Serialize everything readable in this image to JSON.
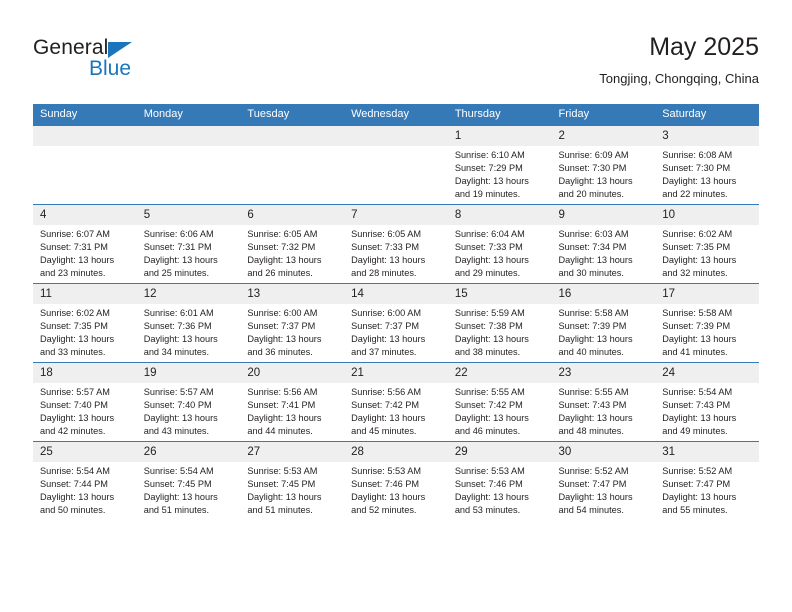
{
  "logo": {
    "word1": "General",
    "word2": "Blue",
    "accent_color": "#1b75bb",
    "triangle_icon": "triangle-icon"
  },
  "header": {
    "title": "May 2025",
    "subtitle": "Tongjing, Chongqing, China",
    "header_bg_color": "#3579b7",
    "daynum_bg_color": "#efefef"
  },
  "weekday_headers": [
    "Sunday",
    "Monday",
    "Tuesday",
    "Wednesday",
    "Thursday",
    "Friday",
    "Saturday"
  ],
  "weeks": [
    [
      {
        "day": "",
        "sunrise": "",
        "sunset": "",
        "daylight_1": "",
        "daylight_2": ""
      },
      {
        "day": "",
        "sunrise": "",
        "sunset": "",
        "daylight_1": "",
        "daylight_2": ""
      },
      {
        "day": "",
        "sunrise": "",
        "sunset": "",
        "daylight_1": "",
        "daylight_2": ""
      },
      {
        "day": "",
        "sunrise": "",
        "sunset": "",
        "daylight_1": "",
        "daylight_2": ""
      },
      {
        "day": "1",
        "sunrise": "Sunrise: 6:10 AM",
        "sunset": "Sunset: 7:29 PM",
        "daylight_1": "Daylight: 13 hours",
        "daylight_2": "and 19 minutes."
      },
      {
        "day": "2",
        "sunrise": "Sunrise: 6:09 AM",
        "sunset": "Sunset: 7:30 PM",
        "daylight_1": "Daylight: 13 hours",
        "daylight_2": "and 20 minutes."
      },
      {
        "day": "3",
        "sunrise": "Sunrise: 6:08 AM",
        "sunset": "Sunset: 7:30 PM",
        "daylight_1": "Daylight: 13 hours",
        "daylight_2": "and 22 minutes."
      }
    ],
    [
      {
        "day": "4",
        "sunrise": "Sunrise: 6:07 AM",
        "sunset": "Sunset: 7:31 PM",
        "daylight_1": "Daylight: 13 hours",
        "daylight_2": "and 23 minutes."
      },
      {
        "day": "5",
        "sunrise": "Sunrise: 6:06 AM",
        "sunset": "Sunset: 7:31 PM",
        "daylight_1": "Daylight: 13 hours",
        "daylight_2": "and 25 minutes."
      },
      {
        "day": "6",
        "sunrise": "Sunrise: 6:05 AM",
        "sunset": "Sunset: 7:32 PM",
        "daylight_1": "Daylight: 13 hours",
        "daylight_2": "and 26 minutes."
      },
      {
        "day": "7",
        "sunrise": "Sunrise: 6:05 AM",
        "sunset": "Sunset: 7:33 PM",
        "daylight_1": "Daylight: 13 hours",
        "daylight_2": "and 28 minutes."
      },
      {
        "day": "8",
        "sunrise": "Sunrise: 6:04 AM",
        "sunset": "Sunset: 7:33 PM",
        "daylight_1": "Daylight: 13 hours",
        "daylight_2": "and 29 minutes."
      },
      {
        "day": "9",
        "sunrise": "Sunrise: 6:03 AM",
        "sunset": "Sunset: 7:34 PM",
        "daylight_1": "Daylight: 13 hours",
        "daylight_2": "and 30 minutes."
      },
      {
        "day": "10",
        "sunrise": "Sunrise: 6:02 AM",
        "sunset": "Sunset: 7:35 PM",
        "daylight_1": "Daylight: 13 hours",
        "daylight_2": "and 32 minutes."
      }
    ],
    [
      {
        "day": "11",
        "sunrise": "Sunrise: 6:02 AM",
        "sunset": "Sunset: 7:35 PM",
        "daylight_1": "Daylight: 13 hours",
        "daylight_2": "and 33 minutes."
      },
      {
        "day": "12",
        "sunrise": "Sunrise: 6:01 AM",
        "sunset": "Sunset: 7:36 PM",
        "daylight_1": "Daylight: 13 hours",
        "daylight_2": "and 34 minutes."
      },
      {
        "day": "13",
        "sunrise": "Sunrise: 6:00 AM",
        "sunset": "Sunset: 7:37 PM",
        "daylight_1": "Daylight: 13 hours",
        "daylight_2": "and 36 minutes."
      },
      {
        "day": "14",
        "sunrise": "Sunrise: 6:00 AM",
        "sunset": "Sunset: 7:37 PM",
        "daylight_1": "Daylight: 13 hours",
        "daylight_2": "and 37 minutes."
      },
      {
        "day": "15",
        "sunrise": "Sunrise: 5:59 AM",
        "sunset": "Sunset: 7:38 PM",
        "daylight_1": "Daylight: 13 hours",
        "daylight_2": "and 38 minutes."
      },
      {
        "day": "16",
        "sunrise": "Sunrise: 5:58 AM",
        "sunset": "Sunset: 7:39 PM",
        "daylight_1": "Daylight: 13 hours",
        "daylight_2": "and 40 minutes."
      },
      {
        "day": "17",
        "sunrise": "Sunrise: 5:58 AM",
        "sunset": "Sunset: 7:39 PM",
        "daylight_1": "Daylight: 13 hours",
        "daylight_2": "and 41 minutes."
      }
    ],
    [
      {
        "day": "18",
        "sunrise": "Sunrise: 5:57 AM",
        "sunset": "Sunset: 7:40 PM",
        "daylight_1": "Daylight: 13 hours",
        "daylight_2": "and 42 minutes."
      },
      {
        "day": "19",
        "sunrise": "Sunrise: 5:57 AM",
        "sunset": "Sunset: 7:40 PM",
        "daylight_1": "Daylight: 13 hours",
        "daylight_2": "and 43 minutes."
      },
      {
        "day": "20",
        "sunrise": "Sunrise: 5:56 AM",
        "sunset": "Sunset: 7:41 PM",
        "daylight_1": "Daylight: 13 hours",
        "daylight_2": "and 44 minutes."
      },
      {
        "day": "21",
        "sunrise": "Sunrise: 5:56 AM",
        "sunset": "Sunset: 7:42 PM",
        "daylight_1": "Daylight: 13 hours",
        "daylight_2": "and 45 minutes."
      },
      {
        "day": "22",
        "sunrise": "Sunrise: 5:55 AM",
        "sunset": "Sunset: 7:42 PM",
        "daylight_1": "Daylight: 13 hours",
        "daylight_2": "and 46 minutes."
      },
      {
        "day": "23",
        "sunrise": "Sunrise: 5:55 AM",
        "sunset": "Sunset: 7:43 PM",
        "daylight_1": "Daylight: 13 hours",
        "daylight_2": "and 48 minutes."
      },
      {
        "day": "24",
        "sunrise": "Sunrise: 5:54 AM",
        "sunset": "Sunset: 7:43 PM",
        "daylight_1": "Daylight: 13 hours",
        "daylight_2": "and 49 minutes."
      }
    ],
    [
      {
        "day": "25",
        "sunrise": "Sunrise: 5:54 AM",
        "sunset": "Sunset: 7:44 PM",
        "daylight_1": "Daylight: 13 hours",
        "daylight_2": "and 50 minutes."
      },
      {
        "day": "26",
        "sunrise": "Sunrise: 5:54 AM",
        "sunset": "Sunset: 7:45 PM",
        "daylight_1": "Daylight: 13 hours",
        "daylight_2": "and 51 minutes."
      },
      {
        "day": "27",
        "sunrise": "Sunrise: 5:53 AM",
        "sunset": "Sunset: 7:45 PM",
        "daylight_1": "Daylight: 13 hours",
        "daylight_2": "and 51 minutes."
      },
      {
        "day": "28",
        "sunrise": "Sunrise: 5:53 AM",
        "sunset": "Sunset: 7:46 PM",
        "daylight_1": "Daylight: 13 hours",
        "daylight_2": "and 52 minutes."
      },
      {
        "day": "29",
        "sunrise": "Sunrise: 5:53 AM",
        "sunset": "Sunset: 7:46 PM",
        "daylight_1": "Daylight: 13 hours",
        "daylight_2": "and 53 minutes."
      },
      {
        "day": "30",
        "sunrise": "Sunrise: 5:52 AM",
        "sunset": "Sunset: 7:47 PM",
        "daylight_1": "Daylight: 13 hours",
        "daylight_2": "and 54 minutes."
      },
      {
        "day": "31",
        "sunrise": "Sunrise: 5:52 AM",
        "sunset": "Sunset: 7:47 PM",
        "daylight_1": "Daylight: 13 hours",
        "daylight_2": "and 55 minutes."
      }
    ]
  ]
}
